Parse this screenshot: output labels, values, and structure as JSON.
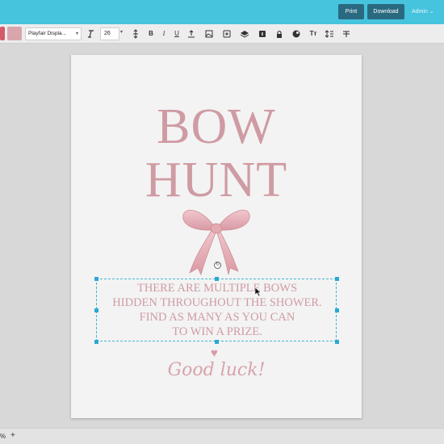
{
  "topbar": {
    "print_label": "Print",
    "download_label": "Download",
    "user_label": "Admin",
    "user_chevron": "⌄"
  },
  "toolbar": {
    "font_family": "Playfair Displa...",
    "font_size": "26",
    "bold": "B",
    "italic": "I",
    "underline": "U",
    "text_case": "Tт",
    "icons": [
      "font-color-icon",
      "line-spacing-icon",
      "bold-icon",
      "italic-icon",
      "underline-icon",
      "align-icon",
      "image-icon",
      "duplicate-icon",
      "layers-icon",
      "download-icon",
      "lock-icon",
      "color-wheel-icon",
      "text-case-icon",
      "list-spacing-icon",
      "strike-icon"
    ]
  },
  "document": {
    "title_line1": "BOW",
    "title_line2": "HUNT",
    "body_line1": "THERE ARE MULTIPLE BOWS",
    "body_line2": "HIDDEN THROUGHOUT THE SHOWER.",
    "body_line3": "FIND AS MANY AS YOU CAN",
    "body_line4": "TO WIN A PRIZE.",
    "heart": "♥",
    "closing": "Good luck!"
  },
  "statusbar": {
    "zoom": "%",
    "add": "+"
  },
  "colors": {
    "topbar": "#46c3dd",
    "button": "#2a6a80",
    "text_pink": "#cf9ba3",
    "selection": "#3fb6d8"
  }
}
